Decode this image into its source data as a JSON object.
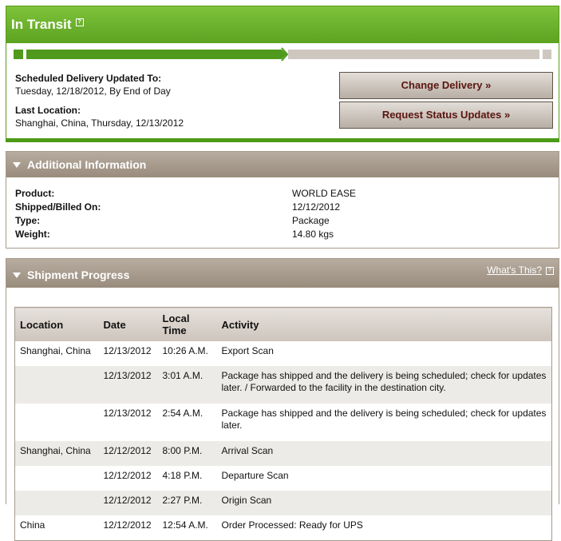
{
  "transit": {
    "title": "In Transit",
    "help_icon_glyph": "?",
    "progress_fraction": 0.5,
    "scheduled_label": "Scheduled Delivery Updated To:",
    "scheduled_value": "Tuesday, 12/18/2012, By End of Day",
    "last_location_label": "Last Location:",
    "last_location_value": "Shanghai, China, Thursday, 12/13/2012",
    "change_delivery_label": "Change Delivery »",
    "request_updates_label": "Request Status Updates »"
  },
  "additional": {
    "title": "Additional Information",
    "rows": [
      {
        "label": "Product:",
        "value": "WORLD EASE"
      },
      {
        "label": "Shipped/Billed On:",
        "value": "12/12/2012"
      },
      {
        "label": "Type:",
        "value": "Package"
      },
      {
        "label": "Weight:",
        "value": "14.80 kgs"
      }
    ]
  },
  "progress": {
    "title": "Shipment Progress",
    "whats_this": "What's This?",
    "columns": {
      "location": "Location",
      "date": "Date",
      "time_line1": "Local",
      "time_line2": "Time",
      "activity": "Activity"
    },
    "rows": [
      {
        "location": "Shanghai, China",
        "date": "12/13/2012",
        "time": "10:26 A.M.",
        "activity": "Export Scan"
      },
      {
        "location": "",
        "date": "12/13/2012",
        "time": "3:01 A.M.",
        "activity": "Package has shipped and the delivery is being scheduled; check for updates later. / Forwarded to the facility in the destination city."
      },
      {
        "location": "",
        "date": "12/13/2012",
        "time": "2:54 A.M.",
        "activity": "Package has shipped and the delivery is being scheduled; check for updates later."
      },
      {
        "location": "Shanghai, China",
        "date": "12/12/2012",
        "time": "8:00 P.M.",
        "activity": "Arrival Scan"
      },
      {
        "location": "",
        "date": "12/12/2012",
        "time": "4:18 P.M.",
        "activity": "Departure Scan"
      },
      {
        "location": "",
        "date": "12/12/2012",
        "time": "2:27 P.M.",
        "activity": "Origin Scan"
      },
      {
        "location": "China",
        "date": "12/12/2012",
        "time": "12:54 A.M.",
        "activity": "Order Processed: Ready for UPS"
      }
    ]
  },
  "colors": {
    "accent_green": "#5ca321",
    "panel_taupe": "#998c7d",
    "button_text": "#5a1510"
  }
}
